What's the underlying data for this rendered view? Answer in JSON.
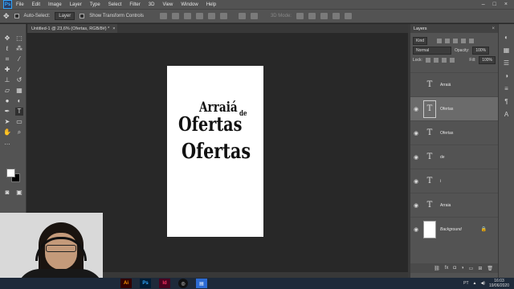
{
  "menubar": {
    "logo": "Ps",
    "items": [
      "File",
      "Edit",
      "Image",
      "Layer",
      "Type",
      "Select",
      "Filter",
      "3D",
      "View",
      "Window",
      "Help"
    ]
  },
  "options": {
    "auto_select_label": "Auto-Select:",
    "auto_select_target": "Layer",
    "show_transform_label": "Show Transform Controls",
    "mode_3d_label": "3D Mode:"
  },
  "document": {
    "tab_title": "Untitled-1 @ 23,6% (Ofertas, RGB/8#) *",
    "tab_close": "×",
    "texts": {
      "arraia": "Arraiá",
      "de": "de",
      "ofertas1": "Ofertas",
      "ofertas2": "Ofertas"
    }
  },
  "layers_panel": {
    "title": "Layers",
    "close": "×",
    "kind": "Kind",
    "blend_mode": "Normal",
    "opacity_label": "Opacity:",
    "opacity_value": "100%",
    "lock_label": "Lock:",
    "fill_label": "Fill:",
    "fill_value": "100%",
    "layers": [
      {
        "name": "Arraiá",
        "visible": false,
        "type": "text"
      },
      {
        "name": "Ofertas",
        "visible": true,
        "type": "text",
        "selected": true
      },
      {
        "name": "Ofertas",
        "visible": true,
        "type": "text"
      },
      {
        "name": "de",
        "visible": true,
        "type": "text"
      },
      {
        "name": "i",
        "visible": true,
        "type": "text"
      },
      {
        "name": "Arraia",
        "visible": true,
        "type": "text"
      },
      {
        "name": "Background",
        "visible": true,
        "type": "background",
        "locked": true
      }
    ]
  },
  "taskbar": {
    "apps": [
      "Ai",
      "Ps",
      "Id",
      "OBS",
      "Explorer"
    ],
    "language": "PT",
    "time": "16:03",
    "date": "19/06/2020"
  },
  "colors": {
    "ui_bg": "#535353",
    "canvas_bg": "#282828",
    "document": "#ffffff",
    "accent_ps": "#31a8ff"
  }
}
